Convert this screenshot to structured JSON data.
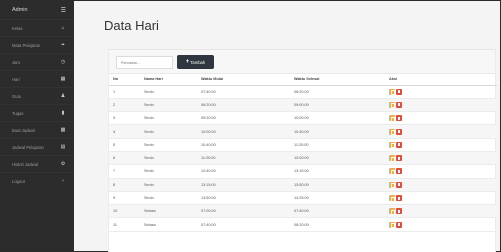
{
  "sidebar": {
    "brand": "Admin",
    "items": [
      {
        "label": "Kelas",
        "icon": "home-icon"
      },
      {
        "label": "Mata Pelajaran",
        "icon": "pin-icon"
      },
      {
        "label": "Jam",
        "icon": "clock-icon"
      },
      {
        "label": "Hari",
        "icon": "calendar-icon"
      },
      {
        "label": "Guru",
        "icon": "user-icon"
      },
      {
        "label": "Tugas",
        "icon": "document-icon"
      },
      {
        "label": "Buat Jadwal",
        "icon": "bar-chart-icon"
      },
      {
        "label": "Jadwal Pelajaran",
        "icon": "list-icon"
      },
      {
        "label": "Histori Jadwal",
        "icon": "gear-icon"
      },
      {
        "label": "Logout",
        "icon": "chevron-right-icon"
      }
    ]
  },
  "main": {
    "title": "Data Hari",
    "search_placeholder": "Pencarian...",
    "add_label": "Tambah",
    "columns": {
      "no": "No",
      "hari": "Nama Hari",
      "mulai": "Waktu Mulai",
      "selesai": "Waktu Selesai",
      "aksi": "Aksi"
    },
    "rows": [
      {
        "no": "1",
        "hari": "Senin",
        "mulai": "07:40:00",
        "selesai": "08:20:00"
      },
      {
        "no": "2",
        "hari": "Senin",
        "mulai": "08:20:00",
        "selesai": "09:00:00"
      },
      {
        "no": "3",
        "hari": "Senin",
        "mulai": "09:20:00",
        "selesai": "10:00:00"
      },
      {
        "no": "4",
        "hari": "Senin",
        "mulai": "10:00:00",
        "selesai": "10:40:00"
      },
      {
        "no": "5",
        "hari": "Senin",
        "mulai": "10:40:00",
        "selesai": "11:20:00"
      },
      {
        "no": "6",
        "hari": "Senin",
        "mulai": "11:20:00",
        "selesai": "12:00:00"
      },
      {
        "no": "7",
        "hari": "Senin",
        "mulai": "12:40:00",
        "selesai": "13:15:00"
      },
      {
        "no": "8",
        "hari": "Senin",
        "mulai": "13:15:00",
        "selesai": "13:50:00"
      },
      {
        "no": "9",
        "hari": "Senin",
        "mulai": "13:50:00",
        "selesai": "14:25:00"
      },
      {
        "no": "10",
        "hari": "Selasa",
        "mulai": "07:00:00",
        "selesai": "07:40:00"
      },
      {
        "no": "11",
        "hari": "Selasa",
        "mulai": "07:40:00",
        "selesai": "08:20:00"
      }
    ]
  },
  "colors": {
    "sidebar": "#2c2c2c",
    "edit": "#f0ad4e",
    "delete": "#e14c3c",
    "button": "#2f3640"
  }
}
